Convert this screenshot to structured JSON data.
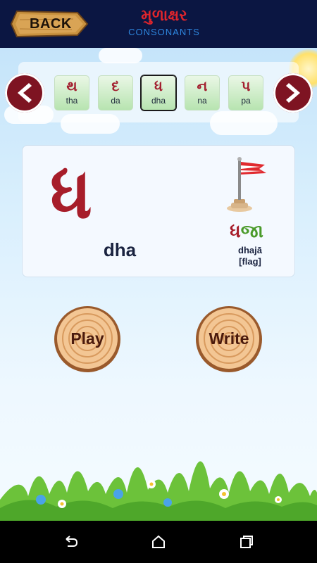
{
  "header": {
    "back_label": "BACK",
    "title_gujarati": "મુળાક્ષર",
    "title_sub": "CONSONANTS"
  },
  "letters": [
    {
      "letter": "થ",
      "roman": "tha"
    },
    {
      "letter": "દ",
      "roman": "da"
    },
    {
      "letter": "ધ",
      "roman": "dha",
      "selected": true
    },
    {
      "letter": "ન",
      "roman": "na"
    },
    {
      "letter": "પ",
      "roman": "pa"
    }
  ],
  "card": {
    "letter": "ધ",
    "roman": "dha",
    "word_part1": "ધ",
    "word_part2": "જા",
    "word_roman": "dhajā",
    "word_meaning": "[flag]"
  },
  "actions": {
    "play_label": "Play",
    "write_label": "Write"
  },
  "icons": {
    "prev": "chevron-left-icon",
    "next": "chevron-right-icon",
    "back": "back-icon",
    "home": "home-icon",
    "recents": "recents-icon"
  },
  "colors": {
    "header_bg": "#0b1642",
    "accent_red": "#a71d2a",
    "accent_green": "#4a9a2a",
    "arrow_bg": "#7e1422"
  }
}
